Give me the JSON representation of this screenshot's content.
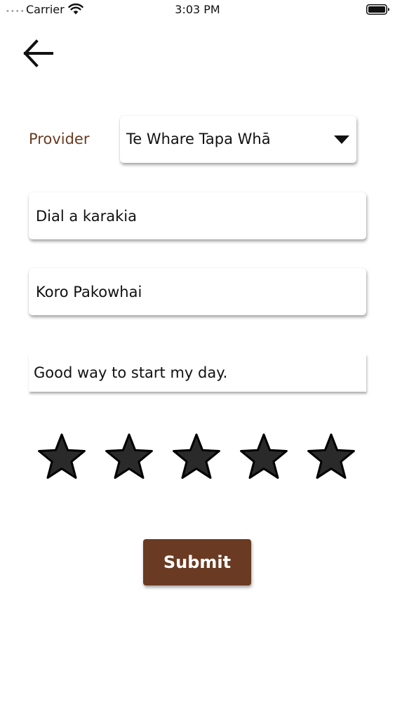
{
  "status_bar": {
    "signal": "••••",
    "carrier": "Carrier",
    "time": "3:03 PM",
    "wifi_icon": "wifi-icon",
    "battery_icon": "battery-full-icon"
  },
  "nav": {
    "back_icon": "arrow-left-icon"
  },
  "form": {
    "provider_label": "Provider",
    "provider_value": "Te Whare Tapa Whā",
    "dropdown_icon": "triangle-down-icon",
    "title_value": "Dial a karakia",
    "name_value": "Koro Pakowhai",
    "comment_value": "Good way to start my day."
  },
  "rating": {
    "value": 5,
    "max": 5,
    "star_fill": "#2b2a2b",
    "star_icon": "star-icon"
  },
  "submit": {
    "label": "Submit"
  },
  "colors": {
    "accent": "#6b3a22",
    "text": "#111111",
    "background": "#ffffff"
  }
}
